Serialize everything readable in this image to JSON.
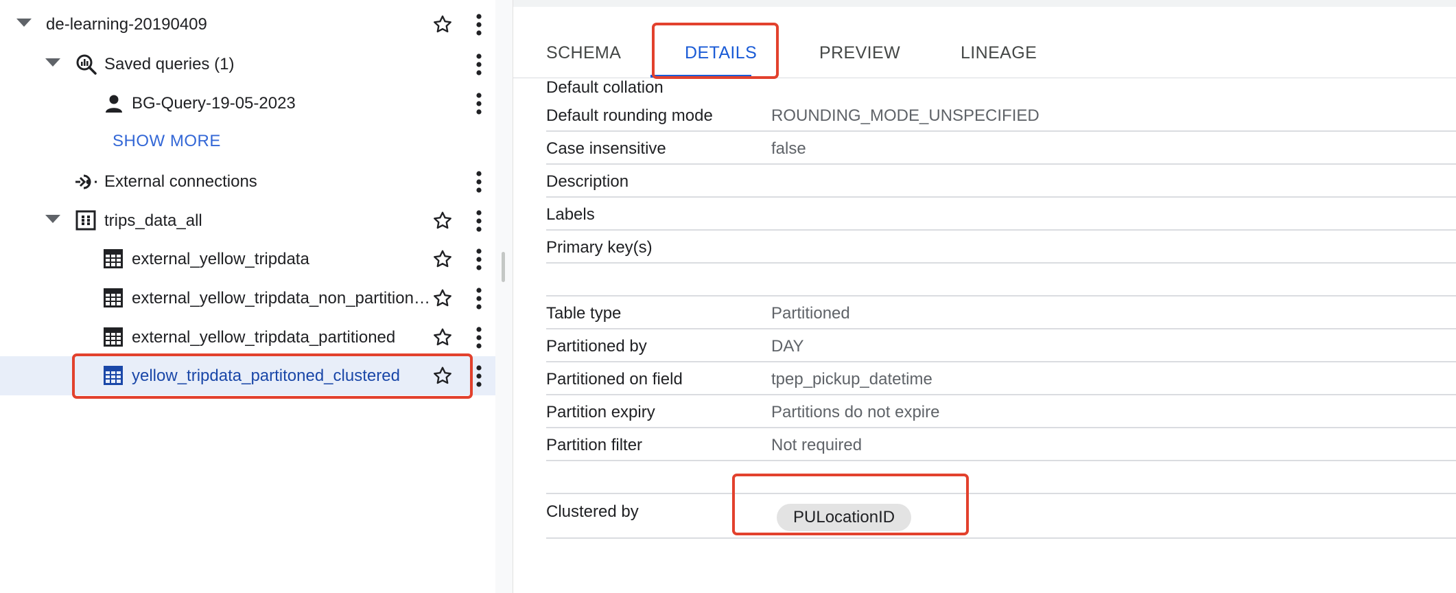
{
  "tree": {
    "project": {
      "label": "de-learning-20190409"
    },
    "saved_queries": {
      "label": "Saved queries (1)"
    },
    "saved_query_item": {
      "label": "BG-Query-19-05-2023"
    },
    "show_more": "SHOW MORE",
    "external_connections": {
      "label": "External connections"
    },
    "dataset": {
      "label": "trips_data_all"
    },
    "tables": [
      {
        "label": "external_yellow_tripdata"
      },
      {
        "label": "external_yellow_tripdata_non_partition…"
      },
      {
        "label": "external_yellow_tripdata_partitioned"
      },
      {
        "label": "yellow_tripdata_partitoned_clustered",
        "selected": true
      }
    ]
  },
  "tabs": [
    {
      "label": "SCHEMA"
    },
    {
      "label": "DETAILS",
      "active": true
    },
    {
      "label": "PREVIEW"
    },
    {
      "label": "LINEAGE"
    }
  ],
  "details": {
    "default_collation": {
      "key": "Default collation",
      "value": ""
    },
    "default_rounding_mode": {
      "key": "Default rounding mode",
      "value": "ROUNDING_MODE_UNSPECIFIED"
    },
    "case_insensitive": {
      "key": "Case insensitive",
      "value": "false"
    },
    "description": {
      "key": "Description",
      "value": ""
    },
    "labels": {
      "key": "Labels",
      "value": ""
    },
    "primary_keys": {
      "key": "Primary key(s)",
      "value": ""
    },
    "table_type": {
      "key": "Table type",
      "value": "Partitioned"
    },
    "partitioned_by": {
      "key": "Partitioned by",
      "value": "DAY"
    },
    "partitioned_on_field": {
      "key": "Partitioned on field",
      "value": "tpep_pickup_datetime"
    },
    "partition_expiry": {
      "key": "Partition expiry",
      "value": "Partitions do not expire"
    },
    "partition_filter": {
      "key": "Partition filter",
      "value": "Not required"
    },
    "clustered_by": {
      "key": "Clustered by",
      "chip": "PULocationID"
    }
  },
  "colors": {
    "accent": "#1a5bd6",
    "highlight_box": "#e2412d",
    "selected_row_bg": "#e8eef9"
  }
}
